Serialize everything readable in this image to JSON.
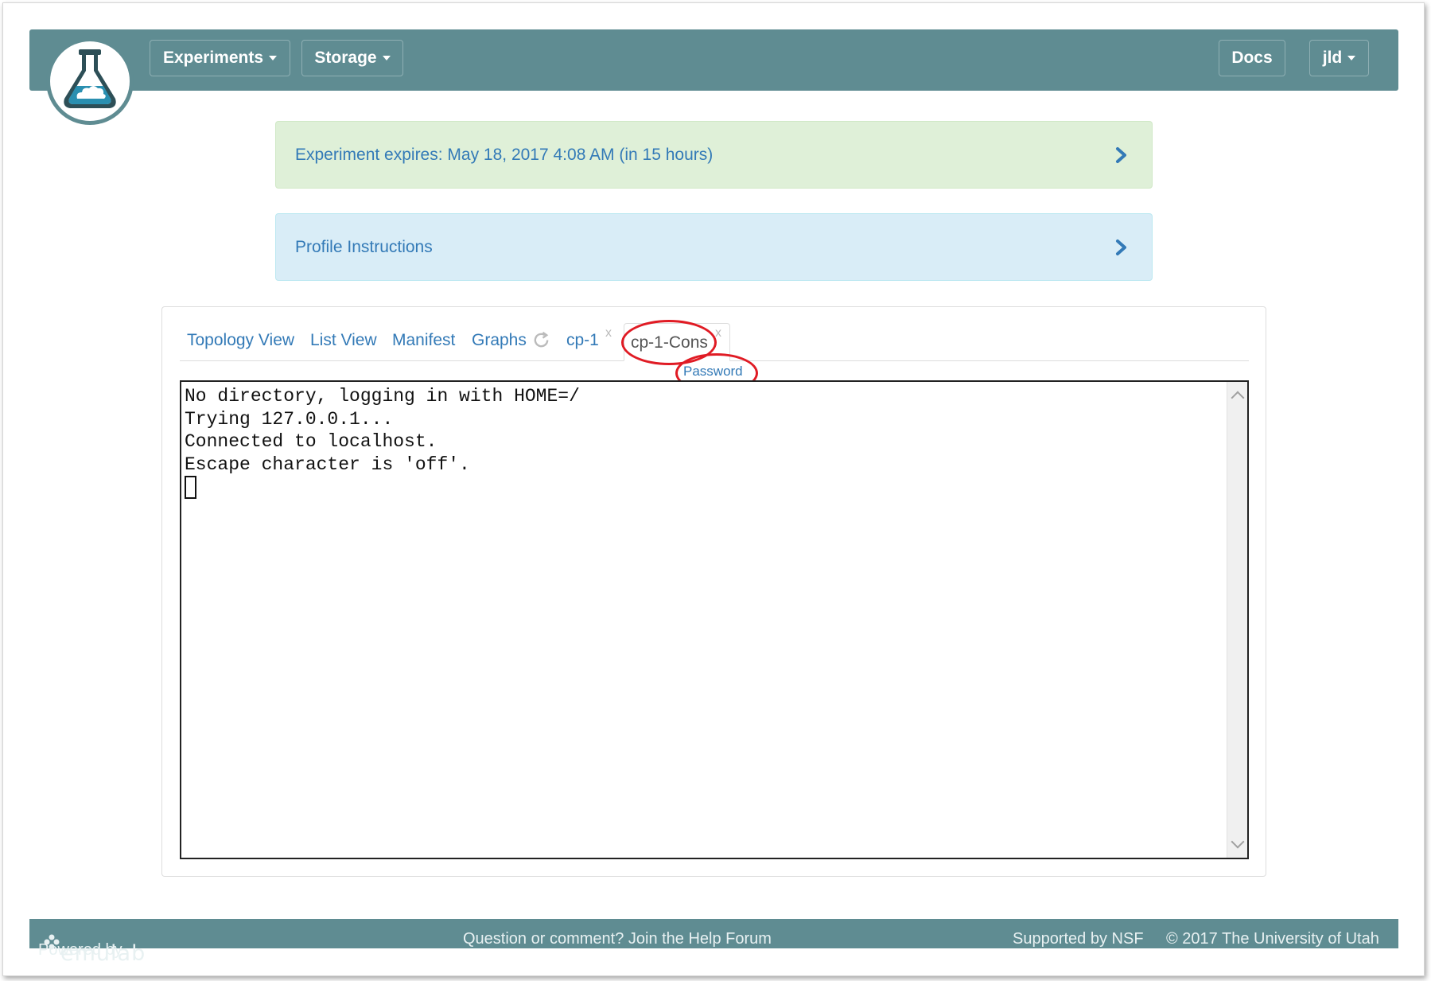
{
  "navbar": {
    "experiments_label": "Experiments",
    "storage_label": "Storage",
    "docs_label": "Docs",
    "user_label": "jld"
  },
  "alerts": {
    "expires_text": "Experiment expires: May 18, 2017 4:08 AM (in 15 hours)",
    "instructions_text": "Profile Instructions"
  },
  "tabs": [
    {
      "label": "Topology View"
    },
    {
      "label": "List View"
    },
    {
      "label": "Manifest"
    },
    {
      "label": "Graphs"
    },
    {
      "label": "cp-1",
      "close": "x"
    },
    {
      "label": "cp-1-Cons",
      "close": "x",
      "active": true
    }
  ],
  "console": {
    "password_link": "Password",
    "lines": [
      "No directory, logging in with HOME=/",
      "Trying 127.0.0.1...",
      "Connected to localhost.",
      "Escape character is 'off'."
    ]
  },
  "footer": {
    "powered_by": "Powered by",
    "brand": "emulab",
    "help_text": "Question or comment? Join the Help Forum",
    "nsf_text": "Supported by NSF",
    "copyright": "© 2017 The University of Utah"
  },
  "colors": {
    "navbar": "#5f8c92",
    "link": "#337ab7",
    "alert_green": "#dff0d8",
    "alert_blue": "#d9edf7",
    "annotation_red": "#e01b24"
  },
  "icons": {
    "logo": "flask-cloud-icon",
    "graphs_refresh": "refresh-icon",
    "panel_toggle": "chevron-right-icon",
    "brand_mark": "flower-icon"
  }
}
